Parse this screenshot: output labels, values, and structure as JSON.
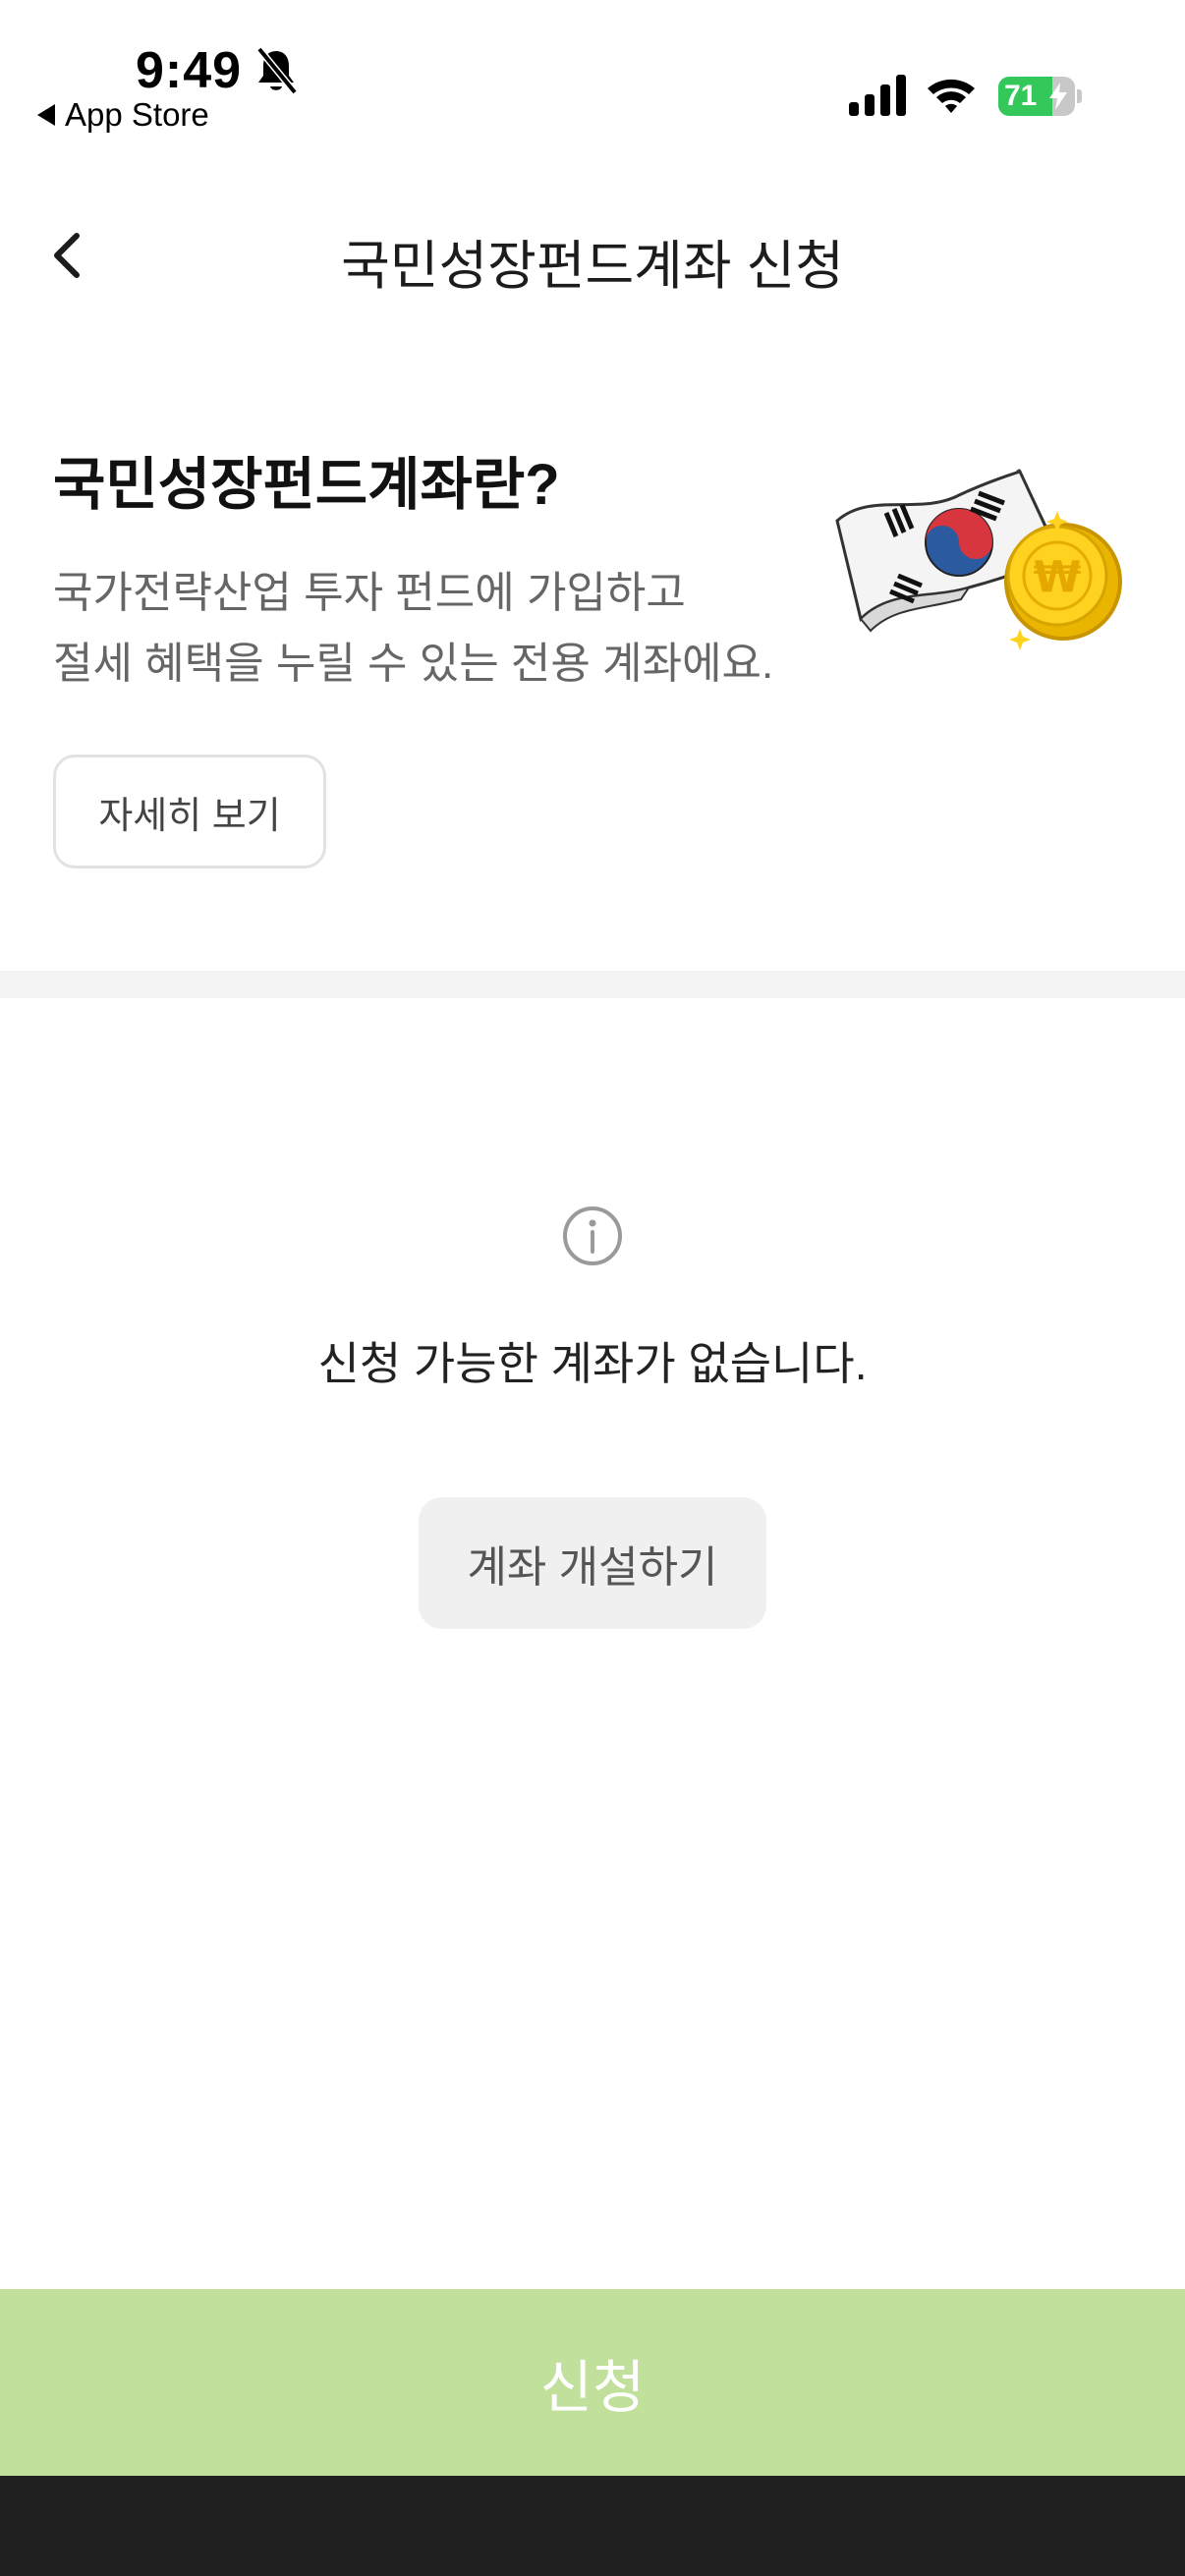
{
  "status_bar": {
    "time": "9:49",
    "back_app_label": "App Store",
    "battery_percent": "71",
    "battery_level": 0.71,
    "icons": [
      "bell-muted-icon",
      "cellular-signal-icon",
      "wifi-icon",
      "battery-charging-icon"
    ]
  },
  "nav": {
    "title": "국민성장펀드계좌 신청",
    "back_icon": "chevron-left-icon"
  },
  "intro": {
    "title": "국민성장펀드계좌란?",
    "description_lines": [
      "국가전략산업 투자 펀드에 가입하고",
      "절세 혜택을 누릴 수 있는 전용 계좌에요."
    ],
    "more_button": "자세히 보기",
    "illustration": "korean-flag-and-won-coin"
  },
  "empty_state": {
    "icon": "info-icon",
    "message": "신청 가능한 계좌가 없습니다.",
    "open_account_button": "계좌 개설하기"
  },
  "footer": {
    "apply_button": "신청"
  },
  "colors": {
    "apply_button_bg": "#c1e09b",
    "battery_green": "#34c759",
    "divider": "#f3f3f3",
    "secondary_button_bg": "#f0f0f0"
  }
}
